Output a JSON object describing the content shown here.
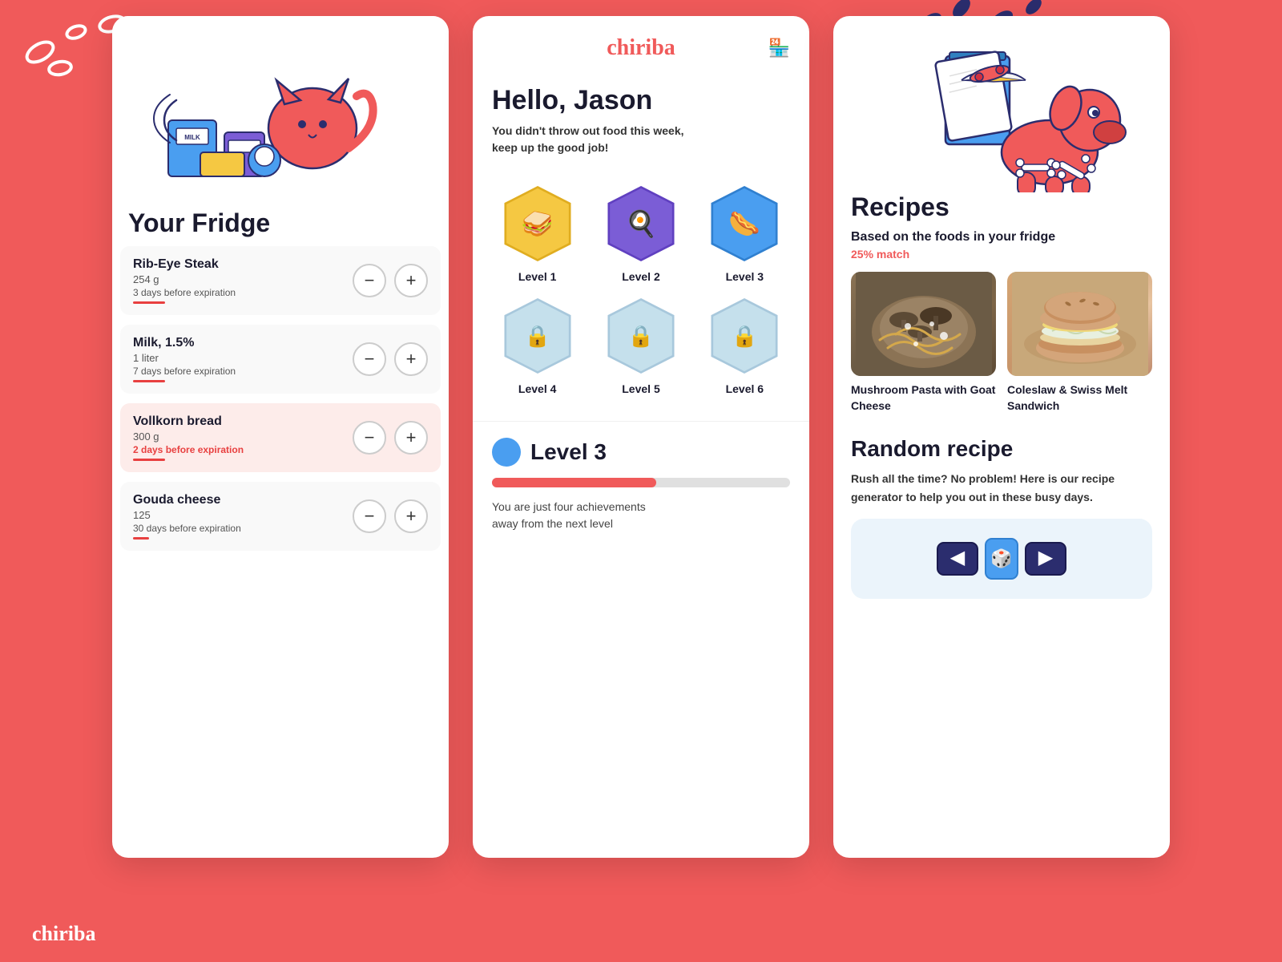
{
  "app": {
    "name": "chiriba",
    "tagline": "chiriba"
  },
  "bottom_bar": {
    "logo": "chiriba"
  },
  "left_panel": {
    "title": "Your Fridge",
    "items": [
      {
        "name": "Rib-Eye Steak",
        "amount": "254 g",
        "expiry": "3 days before expiration",
        "expiry_urgent": false
      },
      {
        "name": "Milk, 1.5%",
        "amount": "1 liter",
        "expiry": "7 days before expiration",
        "expiry_urgent": false
      },
      {
        "name": "Vollkorn bread",
        "amount": "300 g",
        "expiry": "2 days before expiration",
        "expiry_urgent": true
      },
      {
        "name": "Gouda cheese",
        "amount": "125",
        "expiry": "30 days before expiration",
        "expiry_urgent": false
      }
    ]
  },
  "middle_panel": {
    "logo": "chiriba",
    "greeting": "Hello, Jason",
    "subtext": "You didn't throw out food this week,\nkeep up the good job!",
    "levels": [
      {
        "label": "Level 1",
        "color": "#F5C842",
        "unlocked": true,
        "icon": "🥪"
      },
      {
        "label": "Level 2",
        "color": "#7B5DD6",
        "unlocked": true,
        "icon": "🍳"
      },
      {
        "label": "Level 3",
        "color": "#4A9EF0",
        "unlocked": true,
        "icon": "🌭"
      },
      {
        "label": "Level 4",
        "color": "#C5E0EC",
        "unlocked": false,
        "icon": "🔒"
      },
      {
        "label": "Level 5",
        "color": "#C5E0EC",
        "unlocked": false,
        "icon": "🔒"
      },
      {
        "label": "Level 6",
        "color": "#C5E0EC",
        "unlocked": false,
        "icon": "🔒"
      }
    ],
    "current_level": {
      "label": "Level 3",
      "progress_percent": 55,
      "progress_text": "You are just four achievements\naway from the next level"
    }
  },
  "right_panel": {
    "section_title": "Recipes",
    "based_on_title": "Based on the foods in your fridge",
    "match_text": "25% match",
    "recipes": [
      {
        "name": "Mushroom Pasta with Goat Cheese",
        "img_type": "mushroom"
      },
      {
        "name": "Coleslaw & Swiss Melt Sandwich",
        "img_type": "coleslaw"
      }
    ],
    "random_recipe_title": "Random recipe",
    "random_recipe_sub": "Rush all the time? No problem! Here is our recipe\ngenerator to help you out in these busy days."
  }
}
